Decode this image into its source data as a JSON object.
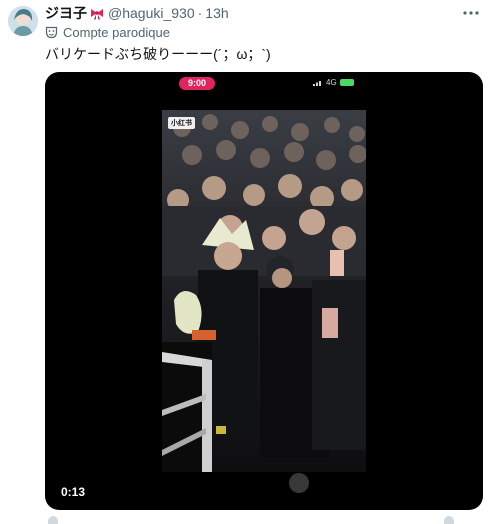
{
  "tweet": {
    "display_name": "ジヨ子",
    "ribbon_icon": "ribbon-emoji-icon",
    "handle": "@haguki_930",
    "separator": "·",
    "time": "13h",
    "more_icon": "more-horizontal-icon",
    "parody_label": "Compte parodique",
    "parody_icon": "theater-mask-icon",
    "text": "バリケードぶち破りーーー(´；ω；`)"
  },
  "media": {
    "status_time": "9:00",
    "network": "4G",
    "watermark": "小红书",
    "duration": "0:13",
    "accent_color": "#e0245e"
  }
}
